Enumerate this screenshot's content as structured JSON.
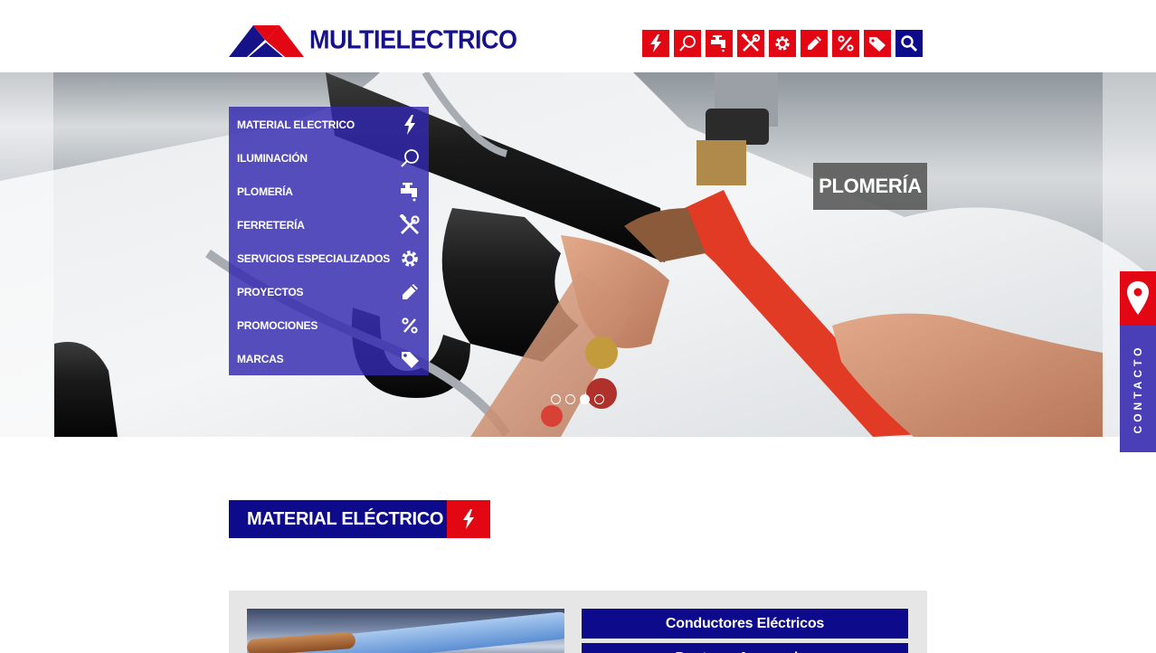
{
  "brand": {
    "name": "MULTIELECTRICO",
    "primary": "#0d0a8c",
    "accent": "#e30613"
  },
  "top_nav": [
    {
      "icon": "bolt-icon"
    },
    {
      "icon": "bulb-icon"
    },
    {
      "icon": "faucet-icon"
    },
    {
      "icon": "tools-icon"
    },
    {
      "icon": "gear-icon"
    },
    {
      "icon": "pencil-icon"
    },
    {
      "icon": "percent-icon"
    },
    {
      "icon": "tags-icon"
    },
    {
      "icon": "search-icon"
    }
  ],
  "category_menu": [
    {
      "label": "MATERIAL ELECTRICO",
      "icon": "bolt-icon"
    },
    {
      "label": "ILUMINACIÓN",
      "icon": "bulb-icon"
    },
    {
      "label": "PLOMERÍA",
      "icon": "faucet-icon"
    },
    {
      "label": "FERRETERÍA",
      "icon": "tools-icon"
    },
    {
      "label": "SERVICIOS ESPECIALIZADOS",
      "icon": "gear-icon"
    },
    {
      "label": "PROYECTOS",
      "icon": "pencil-icon"
    },
    {
      "label": "PROMOCIONES",
      "icon": "percent-icon"
    },
    {
      "label": "MARCAS",
      "icon": "tags-icon"
    }
  ],
  "slider": {
    "label": "PLOMERÍA",
    "slide_count": 4,
    "active_index": 2
  },
  "contact_tab": {
    "label": "CONTACTO",
    "icon": "location-pin-icon"
  },
  "section": {
    "title": "MATERIAL ELÉCTRICO",
    "icon": "bolt-icon",
    "links": [
      "Conductores Eléctricos",
      "Ductos y Accesorios"
    ]
  }
}
